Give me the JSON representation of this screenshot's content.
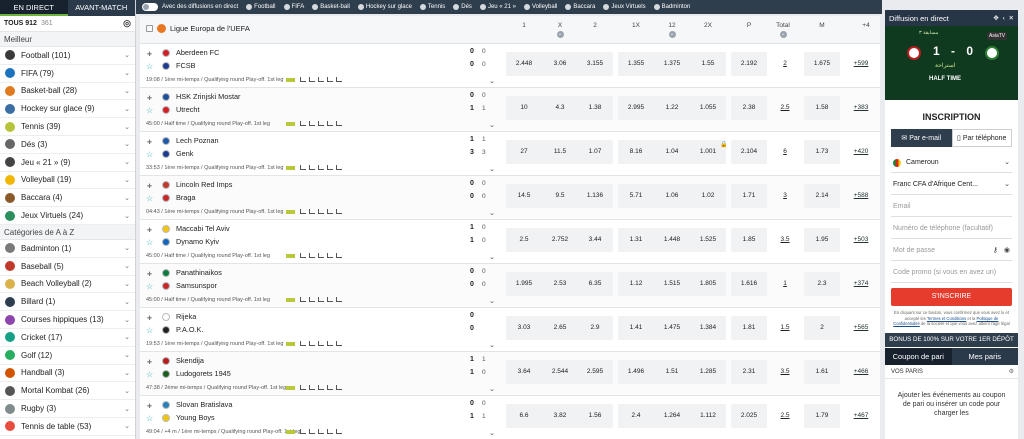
{
  "left": {
    "tabs": [
      "EN DIRECT",
      "AVANT-MATCH"
    ],
    "tous_label": "TOUS 912",
    "tous_count": "361",
    "section1": "Meilleur",
    "items1": [
      "Football (101)",
      "FIFA (79)",
      "Basket-ball (28)",
      "Hockey sur glace (9)",
      "Tennis (39)",
      "Dés (3)",
      "Jeu « 21 » (9)",
      "Volleyball (19)",
      "Baccara (4)",
      "Jeux Virtuels (24)"
    ],
    "section2": "Catégories de A à Z",
    "items2": [
      "Badminton (1)",
      "Baseball (5)",
      "Beach Volleyball (2)",
      "Billard (1)",
      "Courses hippiques (13)",
      "Cricket (17)",
      "Golf (12)",
      "Handball (3)",
      "Mortal Kombat (26)",
      "Rugby (3)",
      "Tennis de table (53)"
    ]
  },
  "topbar": {
    "toggle_label": "Avec des diffusions en direct",
    "sports": [
      "Football",
      "FIFA",
      "Basket-ball",
      "Hockey sur glace",
      "Tennis",
      "Dés",
      "Jeu « 21 »",
      "Volleyball",
      "Baccara",
      "Jeux Virtuels",
      "Badminton"
    ]
  },
  "league": {
    "name": "Ligue Europa de l'UEFA",
    "columns": [
      "1",
      "X",
      "2",
      "1X",
      "12",
      "2X",
      "P",
      "Total",
      "M",
      "+4"
    ]
  },
  "matches": [
    {
      "t1": "Aberdeen FC",
      "t2": "FCSB",
      "s1": "0",
      "s2": "0",
      "g1": "0",
      "g2": "0",
      "info": "19:08 / 1ère mi-temps / Qualifying round Play-off. 1st leg",
      "odds": [
        "2.448",
        "3.06",
        "3.155",
        "1.355",
        "1.375",
        "1.55",
        "2.192",
        "2",
        "1.675"
      ],
      "more": "+599"
    },
    {
      "t1": "HSK Zrinjski Mostar",
      "t2": "Utrecht",
      "s1": "0",
      "s2": "1",
      "g1": "0",
      "g2": "1",
      "info": "45:00 / Half time / Qualifying round Play-off. 1st leg",
      "odds": [
        "10",
        "4.3",
        "1.38",
        "2.995",
        "1.22",
        "1.055",
        "2.38",
        "2.5",
        "1.58"
      ],
      "more": "+383"
    },
    {
      "t1": "Lech Poznan",
      "t2": "Genk",
      "s1": "1",
      "s2": "3",
      "g1": "1",
      "g2": "3",
      "info": "33:53 / 1ère mi-temps / Qualifying round Play-off. 1st leg",
      "odds": [
        "27",
        "11.5",
        "1.07",
        "8.16",
        "1.04",
        "1.001",
        "2.104",
        "6",
        "1.73"
      ],
      "more": "+420"
    },
    {
      "t1": "Lincoln Red Imps",
      "t2": "Braga",
      "s1": "0",
      "s2": "0",
      "g1": "0",
      "g2": "0",
      "info": "04:43 / 1ère mi-temps / Qualifying round Play-off. 1st leg",
      "odds": [
        "14.5",
        "9.5",
        "1.136",
        "5.71",
        "1.06",
        "1.02",
        "1.71",
        "3",
        "2.14"
      ],
      "more": "+588"
    },
    {
      "t1": "Maccabi Tel Aviv",
      "t2": "Dynamo Kyiv",
      "s1": "1",
      "s2": "1",
      "g1": "0",
      "g2": "0",
      "info": "45:00 / Half time / Qualifying round Play-off. 1st leg",
      "odds": [
        "2.5",
        "2.752",
        "3.44",
        "1.31",
        "1.448",
        "1.525",
        "1.85",
        "3.5",
        "1.95"
      ],
      "more": "+503"
    },
    {
      "t1": "Panathinaikos",
      "t2": "Samsunspor",
      "s1": "0",
      "s2": "0",
      "g1": "0",
      "g2": "0",
      "info": "45:00 / Half time / Qualifying round Play-off. 1st leg",
      "odds": [
        "1.995",
        "2.53",
        "6.35",
        "1.12",
        "1.515",
        "1.805",
        "1.616",
        "1",
        "2.3"
      ],
      "more": "+374"
    },
    {
      "t1": "Rijeka",
      "t2": "P.A.O.K.",
      "s1": "0",
      "s2": "0",
      "g1": "",
      "g2": "",
      "info": "19:53 / 1ère mi-temps / Qualifying round Play-off. 1st leg",
      "odds": [
        "3.03",
        "2.65",
        "2.9",
        "1.41",
        "1.475",
        "1.384",
        "1.81",
        "1.5",
        "2"
      ],
      "more": "+565"
    },
    {
      "t1": "Skendija",
      "t2": "Ludogorets 1945",
      "s1": "1",
      "s2": "1",
      "g1": "1",
      "g2": "0",
      "info": "47:38 / 2ème mi-temps / Qualifying round Play-off. 1st leg",
      "odds": [
        "3.64",
        "2.544",
        "2.595",
        "1.496",
        "1.51",
        "1.285",
        "2.31",
        "3.5",
        "1.61"
      ],
      "more": "+466"
    },
    {
      "t1": "Slovan Bratislava",
      "t2": "Young Boys",
      "s1": "0",
      "s2": "1",
      "g1": "0",
      "g2": "1",
      "info": "49:04 / +4 m / 1ère mi-temps / Qualifying round Play-off. 1st leg",
      "odds": [
        "6.6",
        "3.82",
        "1.56",
        "2.4",
        "1.264",
        "1.112",
        "2.025",
        "2.5",
        "1.79"
      ],
      "more": "+467"
    }
  ],
  "right": {
    "live_title": "Diffusion en direct",
    "stream_score": "1 - 0",
    "stream_half": "HALF TIME",
    "stream_ar": "استراحة",
    "stream_top": "مسابقة ٣",
    "stream_logo": "AsiaTV",
    "reg_title": "INSCRIPTION",
    "reg_tab_email": "Par e-mail",
    "reg_tab_phone": "Par téléphone",
    "country": "Cameroun",
    "currency": "Franc CFA d'Afrique Cent...",
    "email_ph": "Email",
    "phone_ph": "Numéro de téléphone (facultatif)",
    "password_ph": "Mot de passe",
    "promo_ph": "Code promo (si vous en avez un)",
    "reg_button": "S'INSCRIRE",
    "legal_1": "En cliquant sur ce bouton, vous confirmez que vous avez lu et accepté les ",
    "legal_link1": "Termes et Conditions",
    "legal_2": " et la ",
    "legal_link2": "Politique de Confidentialité",
    "legal_3": " de la société et que vous avez atteint l'âge légal",
    "bonus": "BONUS DE 100% SUR VOTRE 1ER DÉPÔT",
    "coupon_tabs": [
      "Coupon de pari",
      "Mes paris"
    ],
    "vos_paris": "VOS PARIS",
    "empty_msg": "Ajouter les événements au coupon de pari ou insérer un code pour charger les"
  }
}
